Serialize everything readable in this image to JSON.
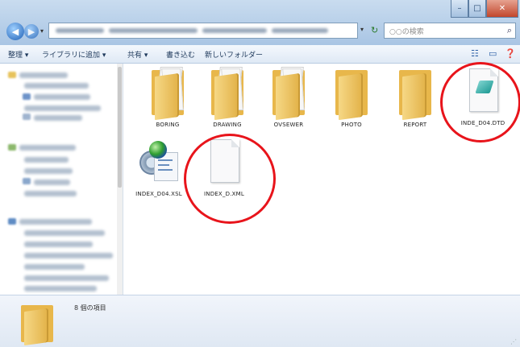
{
  "window": {
    "controls": {
      "minimize": "–",
      "maximize": "□",
      "close": "✕"
    }
  },
  "address_bar": {
    "back_icon": "back-arrow-icon",
    "forward_icon": "forward-arrow-icon",
    "refresh_icon": "refresh-icon",
    "search_placeholder": "○○の検索",
    "search_icon": "search-icon"
  },
  "command_bar": {
    "items": [
      "整理 ▾",
      "ライブラリに追加 ▾",
      "共有 ▾",
      "書き込む",
      "新しいフォルダー"
    ],
    "right_icons": [
      "view-options-icon",
      "preview-pane-icon",
      "help-icon"
    ]
  },
  "files": [
    {
      "name": "BORING",
      "type": "folder"
    },
    {
      "name": "DRAWING",
      "type": "folder"
    },
    {
      "name": "OVSEWER",
      "type": "folder"
    },
    {
      "name": "PHOTO",
      "type": "folder"
    },
    {
      "name": "REPORT",
      "type": "folder"
    },
    {
      "name": "INDE_D04.DTD",
      "type": "dtd"
    },
    {
      "name": "INDEX_D04.XSL",
      "type": "xsl"
    },
    {
      "name": "INDEX_D.XML",
      "type": "xml"
    }
  ],
  "details": {
    "item_count": "8 個の項目"
  },
  "colors": {
    "callout": "#e8141b",
    "folder": "#e8b74b"
  }
}
